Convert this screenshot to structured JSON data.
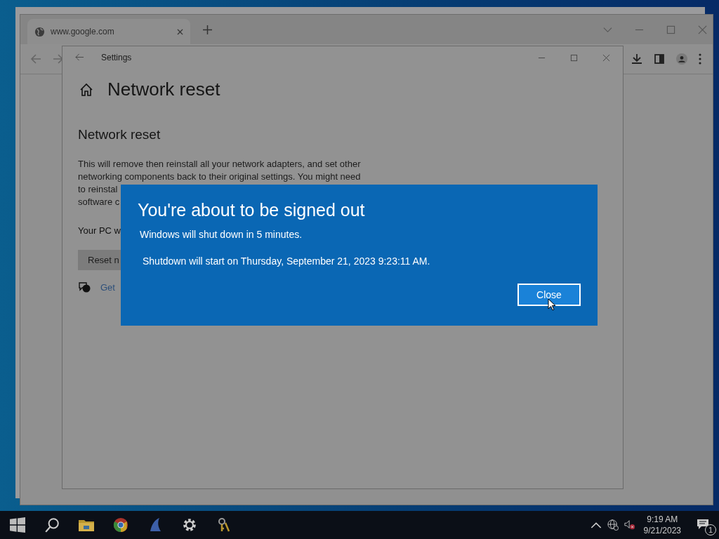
{
  "browser": {
    "tab_title": "www.google.com"
  },
  "settings_window": {
    "title": "Settings",
    "page_title": "Network reset",
    "section_heading": "Network reset",
    "description_lines": [
      "This will remove then reinstall all your network adapters, and set other",
      "networking components back to their original settings. You might need",
      "to reinstal",
      "software c"
    ],
    "note": "Your PC w",
    "reset_button": "Reset n",
    "help_link": "Get"
  },
  "dialog": {
    "title": "You're about to be signed out",
    "message": "Windows will shut down in 5 minutes.",
    "detail": "Shutdown will start on Thursday, September 21, 2023 9:23:11 AM.",
    "button": "Close"
  },
  "taskbar": {
    "time": "9:19 AM",
    "date": "9/21/2023",
    "notification_count": "1"
  }
}
